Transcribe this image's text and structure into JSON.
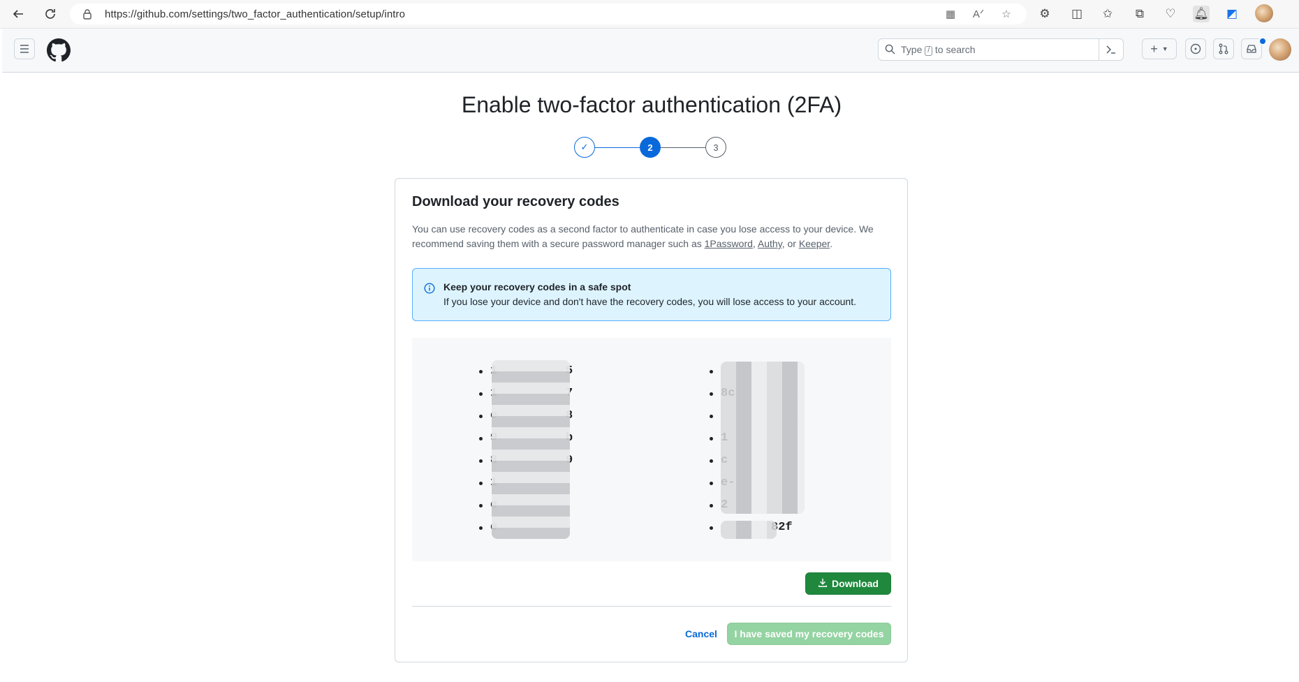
{
  "browser": {
    "url": "https://github.com/settings/two_factor_authentication/setup/intro"
  },
  "header": {
    "search_placeholder_before": "Type",
    "search_slash": "/",
    "search_placeholder_after": "to search"
  },
  "page": {
    "title": "Enable two-factor authentication (2FA)",
    "steps": [
      "✓",
      "2",
      "3"
    ]
  },
  "card": {
    "title": "Download your recovery codes",
    "desc_prefix": "You can use recovery codes as a second factor to authenticate in case you lose access to your device. We recommend saving them with a secure password manager such as ",
    "link1": "1Password",
    "sep1": ", ",
    "link2": "Authy",
    "sep2": ", or ",
    "link3": "Keeper",
    "desc_suffix": ".",
    "flash_title": "Keep your recovery codes in a safe spot",
    "flash_body": "If you lose your device and don't have the recovery codes, you will lose access to your account.",
    "codes_left": [
      "1",
      "1",
      "e",
      "9",
      "8",
      "1",
      "e",
      "e"
    ],
    "codes_left_end": [
      "5",
      "7",
      "8",
      "b",
      "9",
      "",
      "",
      ""
    ],
    "codes_right": [
      "",
      "8c",
      "",
      "1",
      "c",
      "e-",
      "2",
      "82f"
    ],
    "download_label": "Download",
    "cancel_label": "Cancel",
    "saved_label": "I have saved my recovery codes"
  },
  "colors": {
    "primary_blue": "#0969da",
    "success_green": "#1f883d",
    "flash_bg": "#ddf4ff"
  }
}
